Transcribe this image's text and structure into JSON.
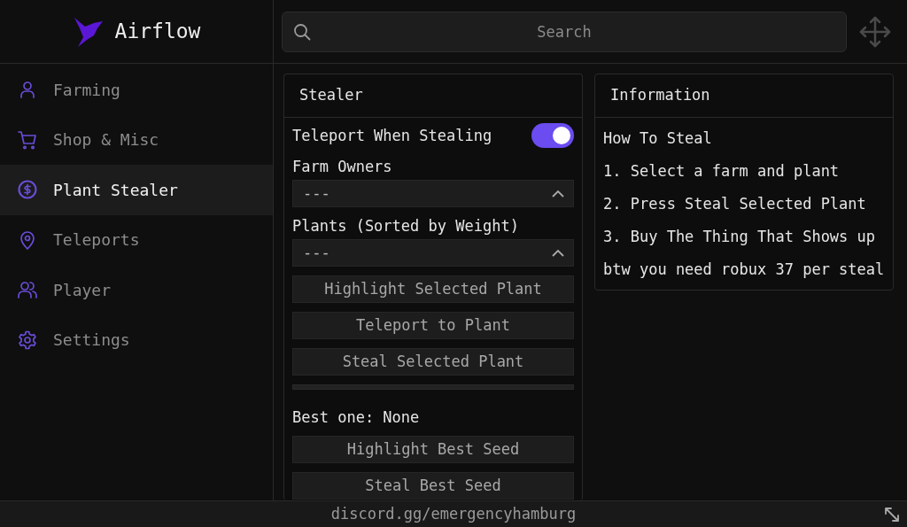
{
  "app": {
    "title": "Airflow"
  },
  "search": {
    "placeholder": "Search"
  },
  "sidebar": {
    "items": [
      {
        "label": "Farming",
        "selected": false
      },
      {
        "label": "Shop & Misc",
        "selected": false
      },
      {
        "label": "Plant Stealer",
        "selected": true
      },
      {
        "label": "Teleports",
        "selected": false
      },
      {
        "label": "Player",
        "selected": false
      },
      {
        "label": "Settings",
        "selected": false
      }
    ]
  },
  "panels": [
    {
      "title": "Stealer",
      "items": [
        {
          "kind": "toggle",
          "label": "Teleport When Stealing",
          "on": true
        },
        {
          "kind": "label",
          "text": "Farm Owners"
        },
        {
          "kind": "dropdown",
          "value": "---"
        },
        {
          "kind": "label",
          "text": "Plants (Sorted by Weight)"
        },
        {
          "kind": "dropdown",
          "value": "---"
        },
        {
          "kind": "button",
          "text": "Highlight Selected Plant"
        },
        {
          "kind": "button",
          "text": "Teleport to Plant"
        },
        {
          "kind": "button",
          "text": "Steal Selected Plant"
        },
        {
          "kind": "separator"
        },
        {
          "kind": "label",
          "text": "Best one: None"
        },
        {
          "kind": "button",
          "text": "Highlight Best Seed"
        },
        {
          "kind": "button",
          "text": "Steal Best Seed"
        }
      ]
    },
    {
      "title": "Information",
      "items": [
        {
          "kind": "label",
          "text": "How To Steal"
        },
        {
          "kind": "label",
          "text": "1. Select a farm and plant"
        },
        {
          "kind": "label",
          "text": "2. Press Steal Selected Plant"
        },
        {
          "kind": "label",
          "text": "3. Buy The Thing That Shows up"
        },
        {
          "kind": "label",
          "text": "btw you need robux 37 per steal"
        }
      ]
    }
  ],
  "footer": {
    "text": "discord.gg/emergencyhamburg"
  }
}
